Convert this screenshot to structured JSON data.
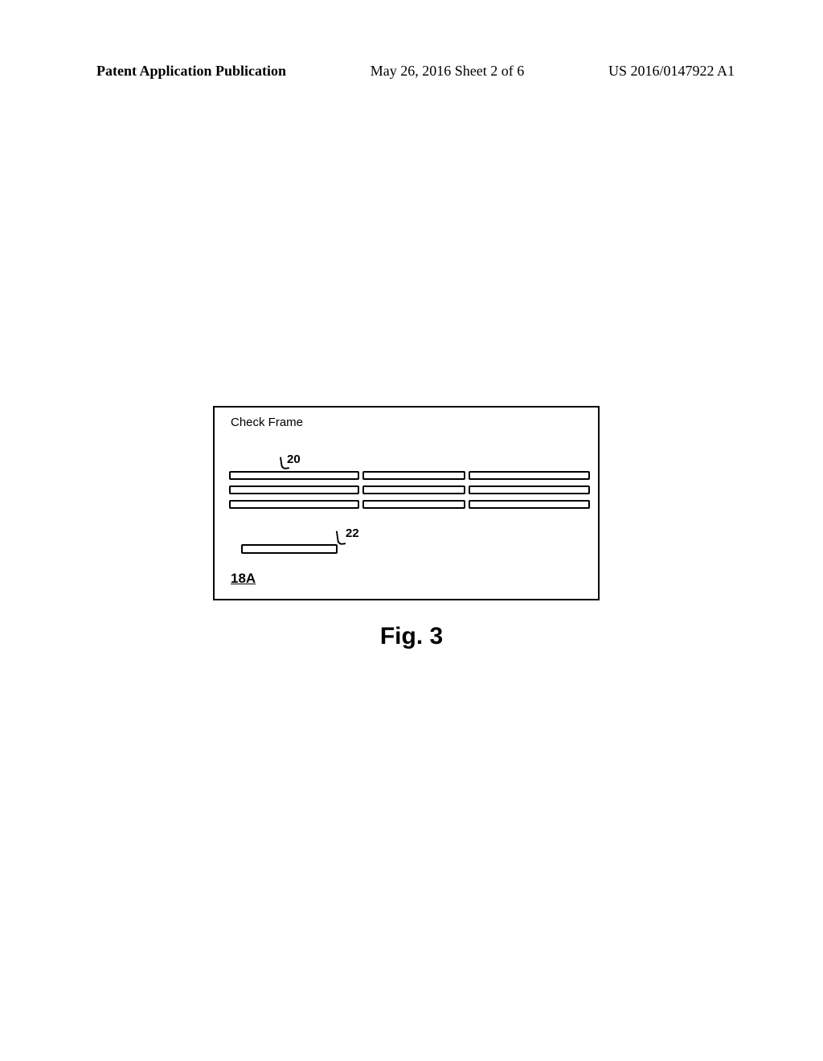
{
  "header": {
    "left": "Patent Application Publication",
    "center": "May 26, 2016  Sheet 2 of 6",
    "right": "US 2016/0147922 A1"
  },
  "figure": {
    "box_title": "Check Frame",
    "label_20": "20",
    "label_22": "22",
    "ref_18a": "18A",
    "caption": "Fig. 3"
  }
}
